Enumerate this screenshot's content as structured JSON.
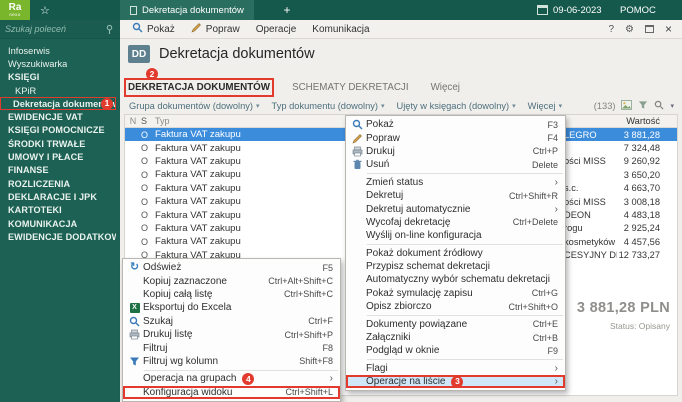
{
  "topbar": {
    "logo": "Ra",
    "logo_sub": "nexo",
    "tab_label": "Dekretacja dokumentów",
    "new_tab": "+",
    "date": "09-06-2023",
    "help": "POMOC"
  },
  "sidebar": {
    "search_placeholder": "Szukaj poleceń",
    "items": [
      {
        "label": "Infoserwis",
        "type": "item"
      },
      {
        "label": "Wyszukiwarka",
        "type": "item"
      },
      {
        "label": "KSIĘGI",
        "type": "group"
      },
      {
        "label": "KPiR",
        "type": "subitem"
      },
      {
        "label": "Dekretacja dokumentów",
        "type": "subitem",
        "active": true,
        "annotation": "1"
      },
      {
        "label": "EWIDENCJE VAT",
        "type": "group"
      },
      {
        "label": "KSIĘGI POMOCNICZE",
        "type": "group"
      },
      {
        "label": "ŚRODKI TRWAŁE",
        "type": "group"
      },
      {
        "label": "UMOWY I PŁACE",
        "type": "group"
      },
      {
        "label": "FINANSE",
        "type": "group"
      },
      {
        "label": "ROZLICZENIA",
        "type": "group"
      },
      {
        "label": "DEKLARACJE I JPK",
        "type": "group"
      },
      {
        "label": "KARTOTEKI",
        "type": "group"
      },
      {
        "label": "KOMUNIKACJA",
        "type": "group"
      },
      {
        "label": "EWIDENCJE DODATKOWE",
        "type": "group"
      }
    ]
  },
  "menubar": {
    "items": [
      {
        "label": "Pokaż",
        "icon": "search-icon"
      },
      {
        "label": "Popraw",
        "icon": "pencil-icon"
      },
      {
        "label": "Operacje"
      },
      {
        "label": "Komunikacja"
      }
    ],
    "help": "?"
  },
  "header": {
    "badge": "DD",
    "title": "Dekretacja dokumentów"
  },
  "tabs": [
    {
      "label": "DEKRETACJA DOKUMENTÓW",
      "active": true,
      "annotation": "2"
    },
    {
      "label": "SCHEMATY DEKRETACJI"
    },
    {
      "label": "Więcej"
    }
  ],
  "filters": {
    "items": [
      "Grupa dokumentów (dowolny)",
      "Typ dokumentu (dowolny)",
      "Ujęty w księgach (dowolny)",
      "Więcej"
    ],
    "count": "(133)"
  },
  "table": {
    "columns": [
      "N",
      "S",
      "Typ",
      "Wartość"
    ],
    "rows": [
      {
        "s": "O",
        "typ": "Faktura VAT zakupu",
        "kontrahent": "LEGRO",
        "wartosc": "3 881,28",
        "selected": true
      },
      {
        "s": "O",
        "typ": "Faktura VAT zakupu",
        "kontrahent": "",
        "wartosc": "7 324,48"
      },
      {
        "s": "O",
        "typ": "Faktura VAT zakupu",
        "kontrahent": "ości MISS",
        "wartosc": "9 260,92"
      },
      {
        "s": "O",
        "typ": "Faktura VAT zakupu",
        "kontrahent": "",
        "wartosc": "3 650,20"
      },
      {
        "s": "O",
        "typ": "Faktura VAT zakupu",
        "kontrahent": "s.c.",
        "wartosc": "4 663,70"
      },
      {
        "s": "O",
        "typ": "Faktura VAT zakupu",
        "kontrahent": "ości MISS",
        "wartosc": "3 008,18"
      },
      {
        "s": "O",
        "typ": "Faktura VAT zakupu",
        "kontrahent": "DEON",
        "wartosc": "4 483,18"
      },
      {
        "s": "O",
        "typ": "Faktura VAT zakupu",
        "kontrahent": "rogu",
        "wartosc": "2 925,24"
      },
      {
        "s": "O",
        "typ": "Faktura VAT zakupu",
        "kontrahent": "kosmetyków BEAT",
        "wartosc": "4 457,56"
      },
      {
        "s": "O",
        "typ": "Faktura VAT zakupu",
        "kontrahent": "CESYJNY DEMO",
        "wartosc": "12 733,27"
      }
    ]
  },
  "summary": {
    "total": "3 881,28 PLN",
    "status": "Status: Opisany"
  },
  "context_menu": {
    "items": [
      {
        "label": "Pokaż",
        "shortcut": "F3",
        "icon": "search-icon"
      },
      {
        "label": "Popraw",
        "shortcut": "F4",
        "icon": "pencil-icon"
      },
      {
        "label": "Drukuj",
        "shortcut": "Ctrl+P",
        "icon": "printer-icon"
      },
      {
        "label": "Usuń",
        "shortcut": "Delete",
        "icon": "trash-icon"
      },
      {
        "type": "separator"
      },
      {
        "label": "Zmień status",
        "submenu": true
      },
      {
        "label": "Dekretuj",
        "shortcut": "Ctrl+Shift+R"
      },
      {
        "label": "Dekretuj automatycznie",
        "submenu": true
      },
      {
        "label": "Wycofaj dekretację",
        "shortcut": "Ctrl+Delete"
      },
      {
        "label": "Wyślij on-line konfiguracja"
      },
      {
        "type": "separator"
      },
      {
        "label": "Pokaż dokument źródłowy"
      },
      {
        "label": "Przypisz schemat dekretacji"
      },
      {
        "label": "Automatyczny wybór schematu dekretacji"
      },
      {
        "label": "Pokaż symulację zapisu",
        "shortcut": "Ctrl+G"
      },
      {
        "label": "Opisz zbiorczo",
        "shortcut": "Ctrl+Shift+O"
      },
      {
        "type": "separator"
      },
      {
        "label": "Dokumenty powiązane",
        "shortcut": "Ctrl+E"
      },
      {
        "label": "Załączniki",
        "shortcut": "Ctrl+B"
      },
      {
        "label": "Podgląd w oknie",
        "shortcut": "F9"
      },
      {
        "type": "separator"
      },
      {
        "label": "Flagi",
        "submenu": true
      },
      {
        "label": "Operacje na liście",
        "submenu": true,
        "highlighted": true,
        "boxed": true,
        "annotation": "3"
      }
    ]
  },
  "list_menu": {
    "items": [
      {
        "label": "Odśwież",
        "shortcut": "F5",
        "icon": "refresh-icon"
      },
      {
        "label": "Kopiuj zaznaczone",
        "shortcut": "Ctrl+Alt+Shift+C"
      },
      {
        "label": "Kopiuj całą listę",
        "shortcut": "Ctrl+Shift+C"
      },
      {
        "label": "Eksportuj do Excela",
        "icon": "excel-icon"
      },
      {
        "label": "Szukaj",
        "shortcut": "Ctrl+F",
        "icon": "search-icon"
      },
      {
        "label": "Drukuj listę",
        "shortcut": "Ctrl+Shift+P",
        "icon": "printer-icon"
      },
      {
        "label": "Filtruj",
        "shortcut": "F8"
      },
      {
        "label": "Filtruj wg kolumn",
        "shortcut": "Shift+F8",
        "icon": "filter-icon"
      },
      {
        "type": "separator"
      },
      {
        "label": "Operacja na grupach",
        "submenu": true,
        "annotation": "4"
      },
      {
        "label": "Konfiguracja widoku",
        "shortcut": "Ctrl+Shift+L",
        "boxed": true
      }
    ]
  }
}
